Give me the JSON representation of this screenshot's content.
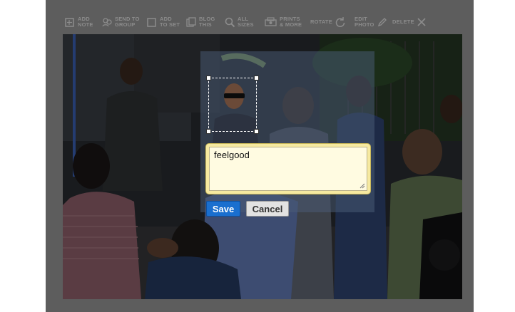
{
  "toolbar": {
    "items": [
      {
        "label": "ADD\nNOTE",
        "icon": "add-note-icon"
      },
      {
        "label": "SEND TO\nGROUP",
        "icon": "send-to-group-icon"
      },
      {
        "label": "ADD\nTO SET",
        "icon": "add-to-set-icon"
      },
      {
        "label": "BLOG\nTHIS",
        "icon": "blog-this-icon"
      },
      {
        "label": "ALL\nSIZES",
        "icon": "magnifier-icon"
      },
      {
        "label": "PRINTS\n& MORE",
        "icon": "prints-icon"
      },
      {
        "label": "ROTATE",
        "icon": "rotate-icon"
      },
      {
        "label": "EDIT\nPHOTO",
        "icon": "pencil-icon"
      },
      {
        "label": "DELETE",
        "icon": "delete-x-icon"
      }
    ]
  },
  "note": {
    "text": "feelgood",
    "save_label": "Save",
    "cancel_label": "Cancel"
  },
  "colors": {
    "frame_bg": "#5d5d5d",
    "save_button": "#1a6fcf",
    "note_bg": "#fffbe1"
  }
}
